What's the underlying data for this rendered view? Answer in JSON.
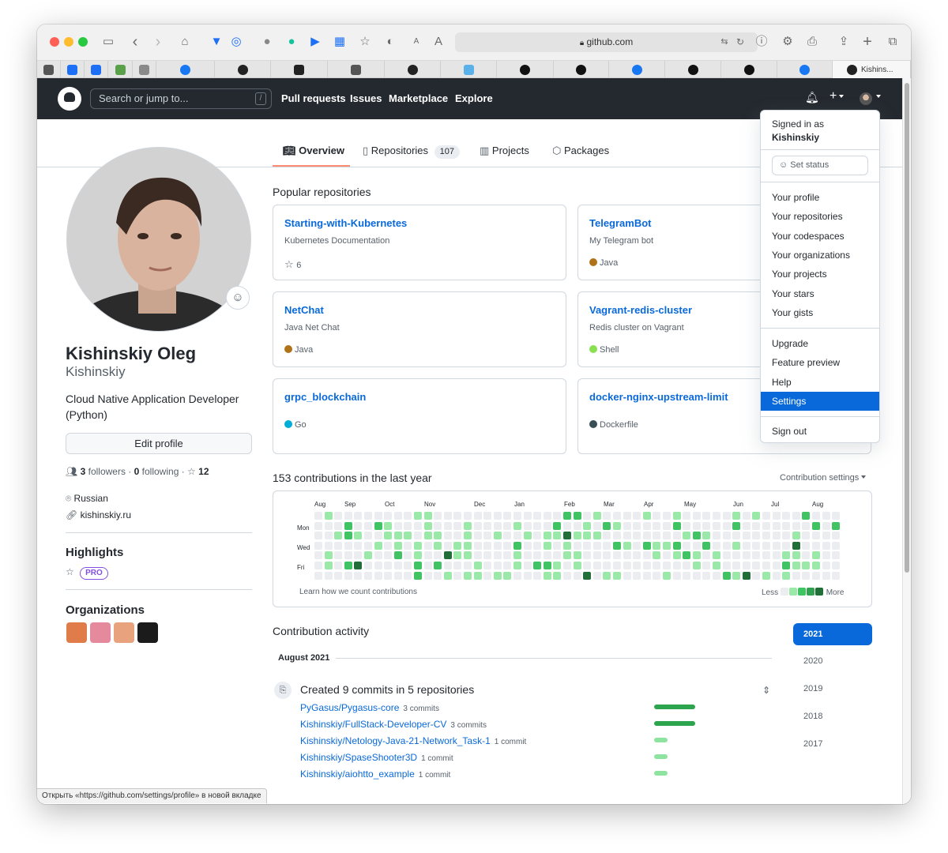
{
  "browser": {
    "address": "github.com",
    "tabs": [
      {
        "label": "",
        "icon": "person-icon",
        "color": "#555555"
      },
      {
        "label": "",
        "icon": "pinwheel-icon",
        "color": "#1d6ff5"
      },
      {
        "label": "",
        "icon": "shield-icon",
        "color": "#1d6ff5"
      },
      {
        "label": "",
        "icon": "money-icon",
        "color": "#5aa04b"
      },
      {
        "label": "",
        "icon": "s-icon",
        "color": "#8a8a8a"
      },
      {
        "label": "",
        "icon": "facebook-icon",
        "color": "#1877f2"
      },
      {
        "label": "",
        "icon": "github-icon",
        "color": "#222222"
      },
      {
        "label": "",
        "icon": "square-icon",
        "color": "#222222"
      },
      {
        "label": "",
        "icon": "person-icon",
        "color": "#555555"
      },
      {
        "label": "",
        "icon": "github-icon",
        "color": "#222222"
      },
      {
        "label": "",
        "icon": "pinwheel-icon",
        "color": "#5ab0e8"
      },
      {
        "label": "",
        "icon": "plus-circle-icon",
        "color": "#111111"
      },
      {
        "label": "",
        "icon": "plus-circle-icon",
        "color": "#111111"
      },
      {
        "label": "",
        "icon": "facebook-icon",
        "color": "#1877f2"
      },
      {
        "label": "",
        "icon": "plus-circle-icon",
        "color": "#111111"
      },
      {
        "label": "",
        "icon": "plus-circle-icon",
        "color": "#111111"
      },
      {
        "label": "",
        "icon": "facebook-icon",
        "color": "#1877f2"
      },
      {
        "label": "Kishins...",
        "icon": "github-icon",
        "color": "#222222"
      }
    ],
    "status_text": "Открыть «https://github.com/settings/profile» в новой вкладке"
  },
  "header": {
    "search_placeholder": "Search or jump to...",
    "search_key": "/",
    "nav": [
      "Pull requests",
      "Issues",
      "Marketplace",
      "Explore"
    ]
  },
  "profile_tabs": {
    "overview": "Overview",
    "repositories": "Repositories",
    "repositories_count": "107",
    "projects": "Projects",
    "packages": "Packages"
  },
  "profile": {
    "name": "Kishinskiy Oleg",
    "login": "Kishinskiy",
    "bio": "Cloud Native Application Developer (Python)",
    "edit_label": "Edit profile",
    "followers_count": "3",
    "followers_label": "followers",
    "following_count": "0",
    "following_label": "following",
    "stars_count": "12",
    "location": "Russian",
    "website": "kishinskiy.ru",
    "highlights_title": "Highlights",
    "pro_badge": "PRO",
    "organizations_title": "Organizations",
    "orgs": [
      {
        "color": "#e07b4a"
      },
      {
        "color": "#e58a9c"
      },
      {
        "color": "#e8a27d"
      },
      {
        "color": "#1b1b1b"
      }
    ]
  },
  "popular": {
    "title": "Popular repositories",
    "repos": [
      {
        "name": "Starting-with-Kubernetes",
        "desc": "Kubernetes Documentation",
        "stars": "6",
        "lang": "",
        "lang_color": ""
      },
      {
        "name": "TelegramBot",
        "desc": "My Telegram bot",
        "stars": "",
        "lang": "Java",
        "lang_color": "#b07219"
      },
      {
        "name": "NetChat",
        "desc": "Java Net Chat",
        "stars": "",
        "lang": "Java",
        "lang_color": "#b07219"
      },
      {
        "name": "Vagrant-redis-cluster",
        "desc": "Redis cluster on Vagrant",
        "stars": "",
        "lang": "Shell",
        "lang_color": "#89e051"
      },
      {
        "name": "grpc_blockchain",
        "desc": "",
        "stars": "",
        "lang": "Go",
        "lang_color": "#00add8"
      },
      {
        "name": "docker-nginx-upstream-limit",
        "desc": "",
        "stars": "",
        "lang": "Dockerfile",
        "lang_color": "#384d54"
      }
    ]
  },
  "contributions": {
    "title": "153 contributions in the last year",
    "settings_label": "Contribution settings",
    "months": [
      "Aug",
      "Sep",
      "Oct",
      "Nov",
      "Dec",
      "Jan",
      "Feb",
      "Mar",
      "Apr",
      "May",
      "Jun",
      "Jul",
      "Aug"
    ],
    "days": [
      "Mon",
      "Wed",
      "Fri"
    ],
    "learn_label": "Learn how we count contributions",
    "less": "Less",
    "more": "More",
    "colors": [
      "#ebedf0",
      "#9be9a8",
      "#40c463",
      "#30a14e",
      "#216e39"
    ]
  },
  "activity": {
    "title": "Contribution activity",
    "month_label": "August 2021",
    "years": [
      "2021",
      "2020",
      "2019",
      "2018",
      "2017"
    ],
    "summary": "Created 9 commits in 5 repositories",
    "items": [
      {
        "repo": "PyGasus/Pygasus-core",
        "commits": "3 commits",
        "fraction": 1.0
      },
      {
        "repo": "Kishinskiy/FullStack-Developer-CV",
        "commits": "3 commits",
        "fraction": 1.0
      },
      {
        "repo": "Kishinskiy/Netology-Java-21-Network_Task-1",
        "commits": "1 commit",
        "fraction": 0.33
      },
      {
        "repo": "Kishinskiy/SpaseShooter3D",
        "commits": "1 commit",
        "fraction": 0.33
      },
      {
        "repo": "Kishinskiy/aiohtto_example",
        "commits": "1 commit",
        "fraction": 0.33
      }
    ]
  },
  "dropdown": {
    "signed_in_as": "Signed in as",
    "user": "Kishinskiy",
    "set_status": "Set status",
    "group1": [
      "Your profile",
      "Your repositories",
      "Your codespaces",
      "Your organizations",
      "Your projects",
      "Your stars",
      "Your gists"
    ],
    "group2": [
      "Upgrade",
      "Feature preview",
      "Help",
      "Settings"
    ],
    "sign_out": "Sign out",
    "selected": "Settings"
  }
}
